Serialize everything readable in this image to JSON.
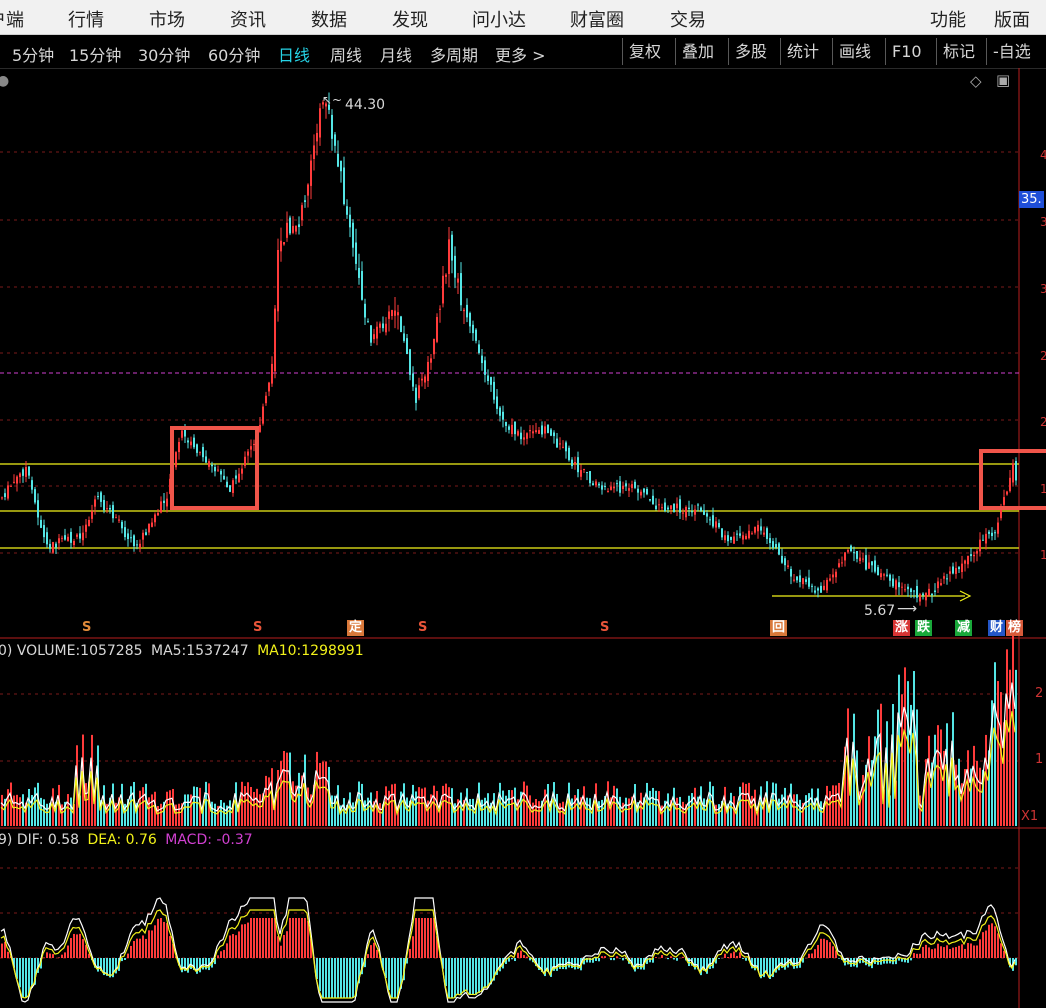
{
  "menu": {
    "left": [
      {
        "label": "客户端",
        "name": "menu-client"
      },
      {
        "label": "行情",
        "name": "menu-quotes"
      },
      {
        "label": "市场",
        "name": "menu-market"
      },
      {
        "label": "资讯",
        "name": "menu-news"
      },
      {
        "label": "数据",
        "name": "menu-data"
      },
      {
        "label": "发现",
        "name": "menu-discover"
      },
      {
        "label": "问小达",
        "name": "menu-ask"
      },
      {
        "label": "财富圈",
        "name": "menu-wealth"
      },
      {
        "label": "交易",
        "name": "menu-trade"
      }
    ],
    "right": [
      {
        "label": "功能",
        "name": "menu-functions"
      },
      {
        "label": "版面",
        "name": "menu-layout"
      }
    ]
  },
  "toolbar": {
    "periods": [
      "5分钟",
      "15分钟",
      "30分钟",
      "60分钟",
      "日线",
      "周线",
      "月线",
      "多周期",
      "更多 >"
    ],
    "active_period": "日线",
    "right_buttons": [
      "复权",
      "叠加",
      "多股",
      "统计",
      "画线",
      "F10",
      "标记",
      "-自选"
    ]
  },
  "main_chart": {
    "high_label": "44.30",
    "low_label": "5.67",
    "price_tag": "35.",
    "axis_right_labels": [
      "4",
      "3",
      "3",
      "2",
      "2",
      "1",
      "1"
    ],
    "event_tags": [
      {
        "text": "S",
        "type": "s"
      },
      {
        "text": "S",
        "type": "s"
      },
      {
        "text": "定",
        "type": "ding"
      },
      {
        "text": "S",
        "type": "s"
      },
      {
        "text": "S",
        "type": "s"
      },
      {
        "text": "回",
        "type": "hui"
      },
      {
        "text": "涨",
        "type": "zhang"
      },
      {
        "text": "跌",
        "type": "die"
      },
      {
        "text": "减",
        "type": "jian"
      },
      {
        "text": "财",
        "type": "cai"
      },
      {
        "text": "榜",
        "type": "bang"
      }
    ]
  },
  "volume_panel": {
    "prefix": "0)",
    "volume_label": "VOLUME:",
    "volume_value": "1057285",
    "ma5_label": "MA5:",
    "ma5_value": "1537247",
    "ma10_label": "MA10:",
    "ma10_value": "1298991",
    "axis_labels": [
      "2",
      "1"
    ],
    "unit_label": "X1"
  },
  "macd_panel": {
    "prefix": "9)",
    "dif_label": "DIF:",
    "dif_value": "0.58",
    "dea_label": "DEA:",
    "dea_value": "0.76",
    "macd_label": "MACD:",
    "macd_value": "-0.37"
  },
  "colors": {
    "up": "#ff3b3b",
    "down": "#54e6e6",
    "yellow_line": "#f2f21a",
    "magenta": "#d040d0",
    "highlight_box": "#f0554a",
    "active_tab": "#26d3e6",
    "price_tag_bg": "#1f4fd8"
  }
}
